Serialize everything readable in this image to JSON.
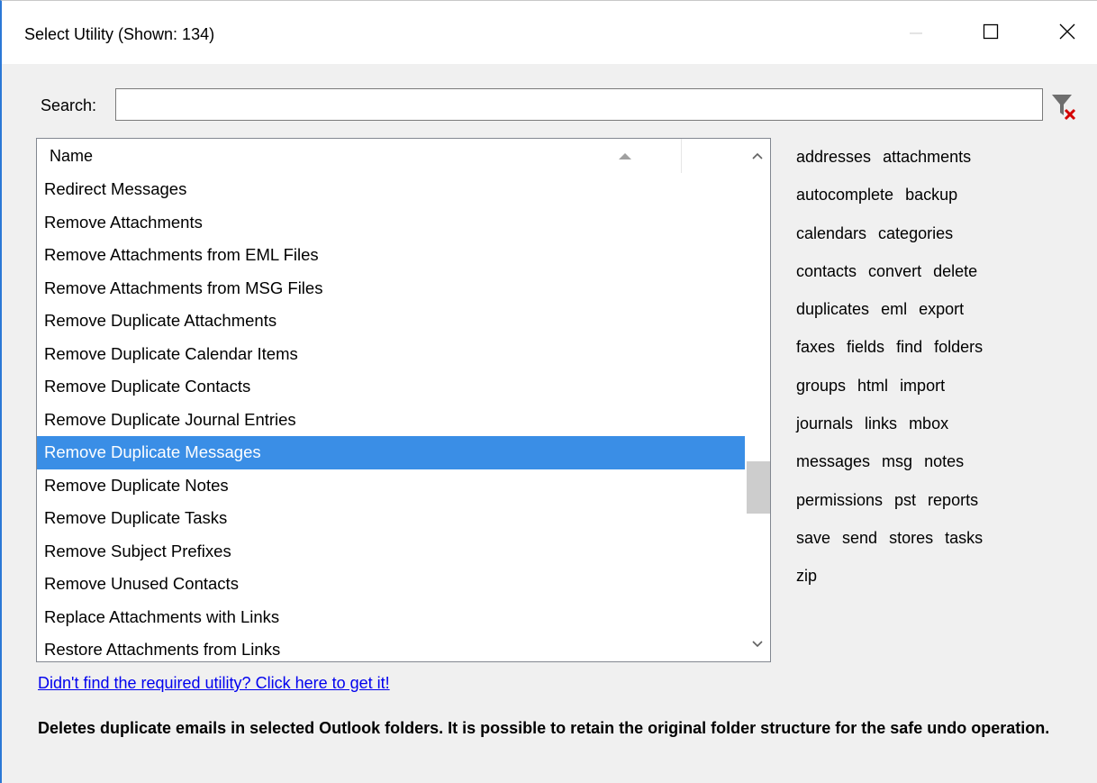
{
  "window": {
    "title": "Select Utility (Shown: 134)"
  },
  "search": {
    "label": "Search:",
    "value": "",
    "placeholder": ""
  },
  "list": {
    "column_header": "Name",
    "selected_index": 8,
    "rows": [
      "Redirect Messages",
      "Remove Attachments",
      "Remove Attachments from EML Files",
      "Remove Attachments from MSG Files",
      "Remove Duplicate Attachments",
      "Remove Duplicate Calendar Items",
      "Remove Duplicate Contacts",
      "Remove Duplicate Journal Entries",
      "Remove Duplicate Messages",
      "Remove Duplicate Notes",
      "Remove Duplicate Tasks",
      "Remove Subject Prefixes",
      "Remove Unused Contacts",
      "Replace Attachments with Links",
      "Restore Attachments from Links"
    ]
  },
  "tags": [
    [
      "addresses",
      "attachments"
    ],
    [
      "autocomplete",
      "backup"
    ],
    [
      "calendars",
      "categories"
    ],
    [
      "contacts",
      "convert",
      "delete"
    ],
    [
      "duplicates",
      "eml",
      "export"
    ],
    [
      "faxes",
      "fields",
      "find",
      "folders"
    ],
    [
      "groups",
      "html",
      "import"
    ],
    [
      "journals",
      "links",
      "mbox"
    ],
    [
      "messages",
      "msg",
      "notes"
    ],
    [
      "permissions",
      "pst",
      "reports"
    ],
    [
      "save",
      "send",
      "stores",
      "tasks"
    ],
    [
      "zip"
    ]
  ],
  "link": {
    "text": "Didn't find the required utility? Click here to get it!"
  },
  "description": "Deletes duplicate emails in selected Outlook folders. It is possible to retain the original folder structure for the safe undo operation.",
  "colors": {
    "selection": "#3a8ee6",
    "link": "#0000ee",
    "window_accent": "#2b78d6",
    "filter_clear_x": "#d40000"
  }
}
